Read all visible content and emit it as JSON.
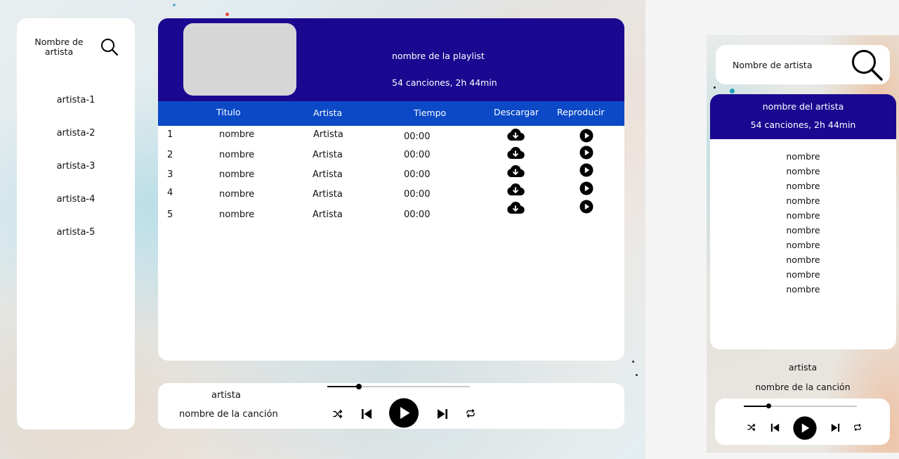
{
  "sidebar": {
    "search_label": "Nombre de artista",
    "search_icon": "search-icon",
    "artists": [
      "artista-1",
      "artista-2",
      "artista-3",
      "artista-4",
      "artista-5"
    ]
  },
  "playlist": {
    "name": "nombre de la playlist",
    "meta": "54 canciones, 2h 44min",
    "columns": {
      "title": "Titulo",
      "artist": "Artista",
      "time": "Tiempo",
      "download": "Descargar",
      "play": "Reproducir"
    },
    "rows": [
      {
        "num": "1",
        "title": "nombre",
        "artist": "Artista",
        "time": "00:00"
      },
      {
        "num": "2",
        "title": "nombre",
        "artist": "Artista",
        "time": "00:00"
      },
      {
        "num": "3",
        "title": "nombre",
        "artist": "Artista",
        "time": "00:00"
      },
      {
        "num": "4",
        "title": "nombre",
        "artist": "Artista",
        "time": "00:00"
      },
      {
        "num": "5",
        "title": "nombre",
        "artist": "Artista",
        "time": "00:00"
      }
    ],
    "row_icons": {
      "download": "cloud-download-icon",
      "play": "play-circle-icon"
    }
  },
  "player": {
    "artist": "artista",
    "song": "nombre de la canción",
    "progress": 0.22,
    "icons": [
      "shuffle-icon",
      "skip-back-icon",
      "play-icon",
      "skip-forward-icon",
      "repeat-icon"
    ]
  },
  "mobile": {
    "search_label": "Nombre de artista",
    "artist_name": "nombre del artista",
    "meta": "54 canciones, 2h 44min",
    "songs": [
      "nombre",
      "nombre",
      "nombre",
      "nombre",
      "nombre",
      "nombre",
      "nombre",
      "nombre",
      "nombre",
      "nombre"
    ],
    "now_artist": "artista",
    "now_song": "nombre de la canción",
    "progress": 0.22
  },
  "colors": {
    "header": "#1b0890",
    "table_header": "#0b49c6",
    "cover_placeholder": "#d6d6d6"
  }
}
